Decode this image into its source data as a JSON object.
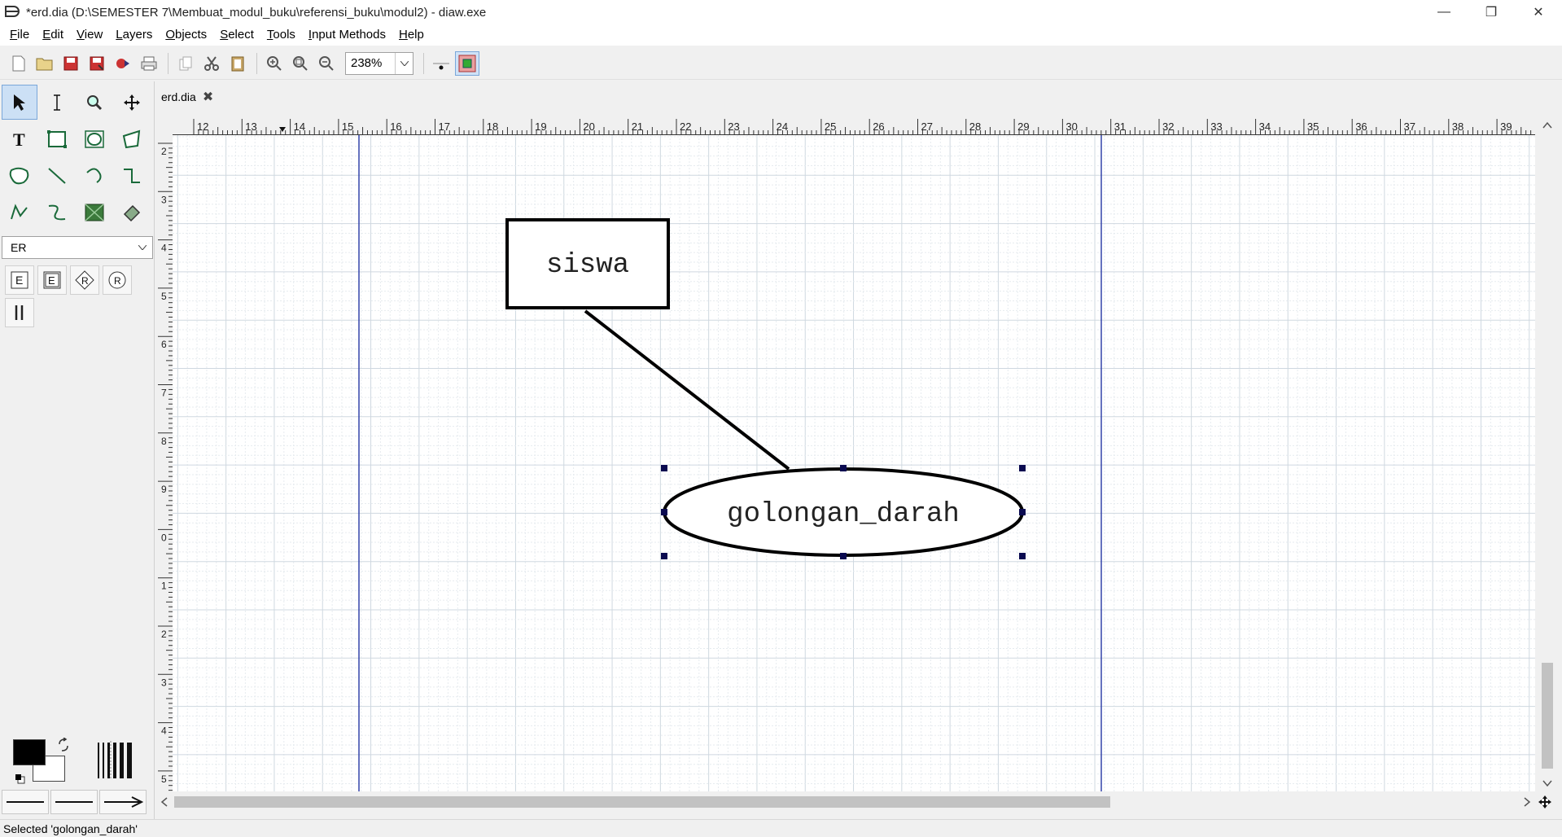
{
  "window": {
    "title": "*erd.dia (D:\\SEMESTER 7\\Membuat_modul_buku\\referensi_buku\\modul2) - diaw.exe",
    "minimize": "—",
    "restore": "❐",
    "close": "✕"
  },
  "menu": [
    {
      "u": "F",
      "rest": "ile"
    },
    {
      "u": "E",
      "rest": "dit"
    },
    {
      "u": "V",
      "rest": "iew"
    },
    {
      "u": "L",
      "rest": "ayers"
    },
    {
      "u": "O",
      "rest": "bjects"
    },
    {
      "u": "S",
      "rest": "elect"
    },
    {
      "u": "T",
      "rest": "ools"
    },
    {
      "u": "I",
      "rest": "nput Methods"
    },
    {
      "u": "H",
      "rest": "elp"
    }
  ],
  "toolbar": {
    "zoom": "238%"
  },
  "sheet": {
    "selected": "ER"
  },
  "tab": {
    "label": "erd.dia",
    "close": "✖"
  },
  "ruler": {
    "h_labels": [
      "12",
      "13",
      "14",
      "15",
      "16",
      "17",
      "18",
      "19",
      "20",
      "21",
      "22",
      "23",
      "24",
      "25",
      "26",
      "27",
      "28",
      "29",
      "30",
      "31",
      "32",
      "33",
      "34",
      "35",
      "36",
      "37",
      "38",
      "39"
    ],
    "v_labels": [
      "2",
      "3",
      "4",
      "5",
      "6",
      "7",
      "8",
      "9",
      "0",
      "1",
      "2",
      "3",
      "4",
      "5"
    ]
  },
  "diagram": {
    "entity_label": "siswa",
    "attribute_label": "golongan_darah"
  },
  "status": {
    "text": "Selected 'golongan_darah'"
  }
}
